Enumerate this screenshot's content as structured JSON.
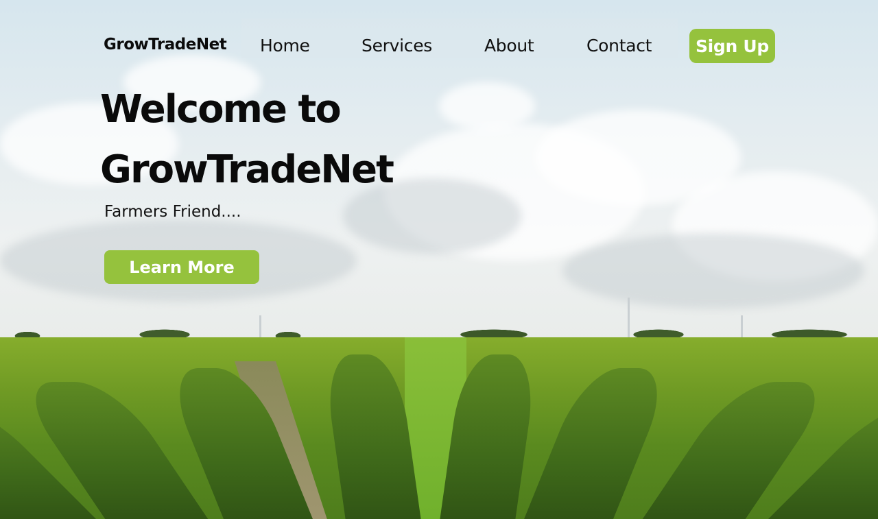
{
  "header": {
    "logo": "GrowTradeNet",
    "nav": [
      {
        "label": "Home"
      },
      {
        "label": "Services"
      },
      {
        "label": "About"
      },
      {
        "label": "Contact"
      }
    ],
    "signup_label": "Sign Up"
  },
  "hero": {
    "title_line1": "Welcome to",
    "title_line2": "GrowTradeNet",
    "tagline": "Farmers Friend....",
    "cta_label": "Learn More"
  },
  "colors": {
    "accent": "#95c23d",
    "text": "#0a0a0a"
  }
}
